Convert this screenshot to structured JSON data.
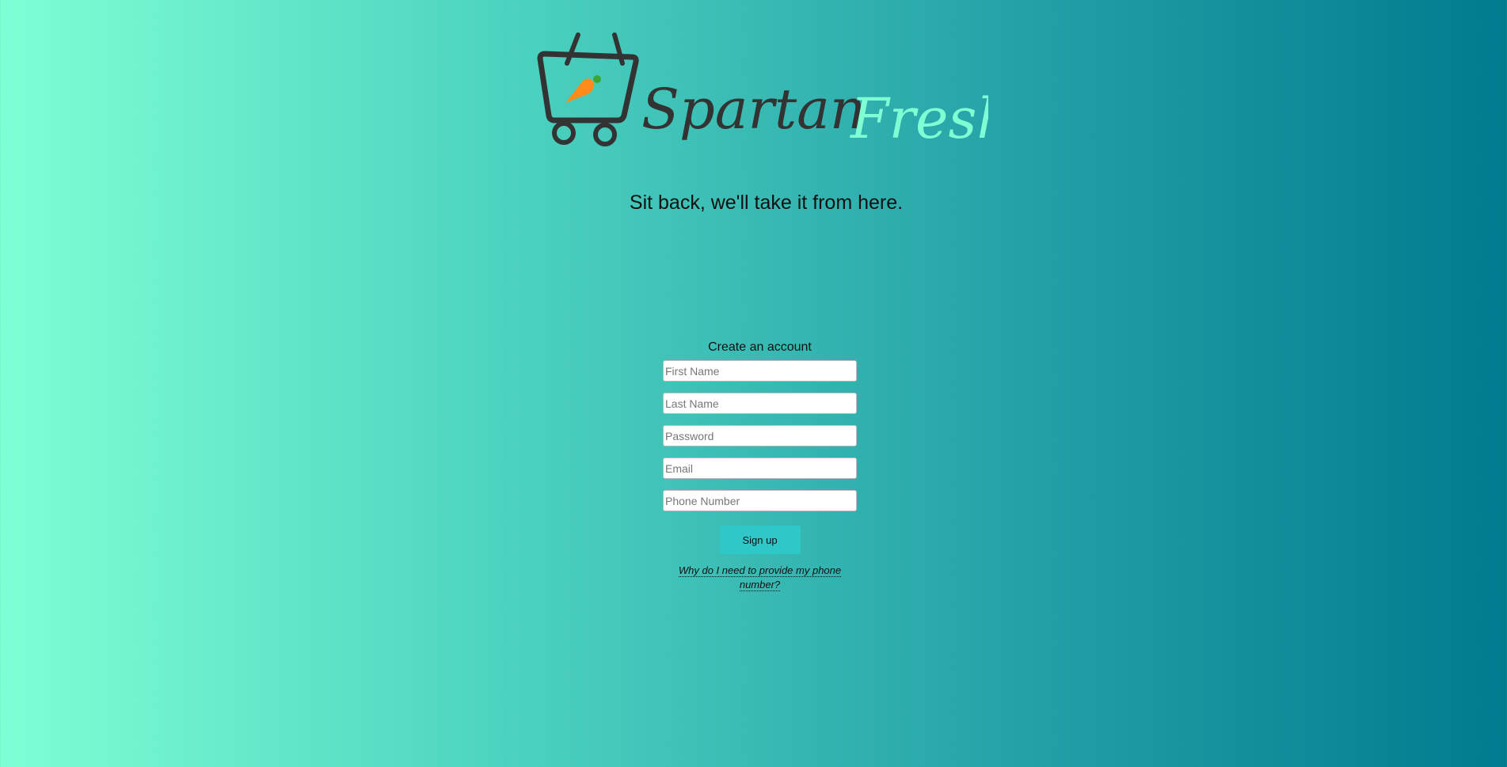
{
  "brand": {
    "name_part1": "Spartan",
    "name_part2": "Fresh",
    "logo_icon": "shopping-basket-carrot-icon"
  },
  "tagline": "Sit back, we'll take it from here.",
  "form": {
    "title": "Create an account",
    "fields": [
      {
        "placeholder": "First Name",
        "value": ""
      },
      {
        "placeholder": "Last Name",
        "value": ""
      },
      {
        "placeholder": "Password",
        "value": ""
      },
      {
        "placeholder": "Email",
        "value": ""
      },
      {
        "placeholder": "Phone Number",
        "value": ""
      }
    ],
    "submit_label": "Sign up",
    "help_link": "Why do I need to provide my phone number?"
  },
  "colors": {
    "gradient_start": "#7fffd4",
    "gradient_end": "#007b8f",
    "button": "#2ec8c8",
    "carrot": "#ff8c1a",
    "brand_accent": "#7fffd4"
  }
}
